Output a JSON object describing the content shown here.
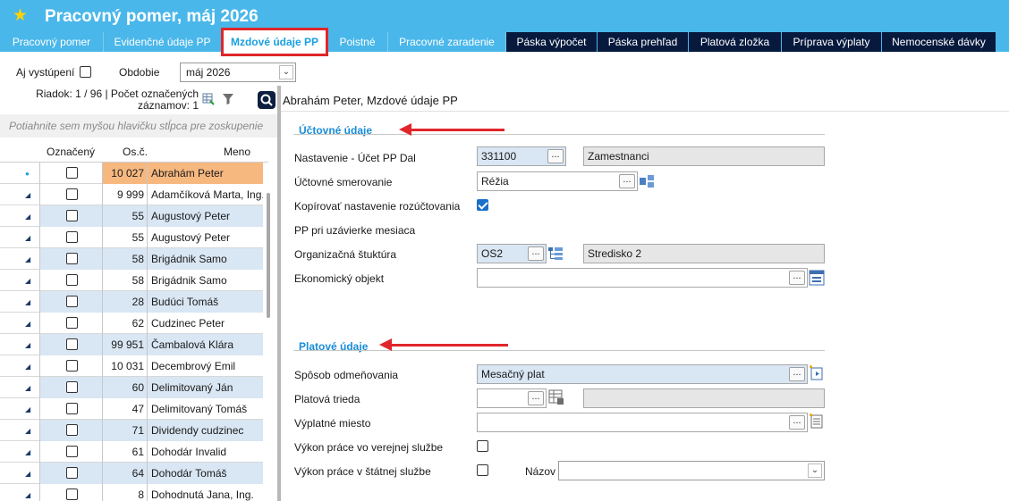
{
  "header": {
    "title": "Pracovný pomer, máj 2026",
    "tabs": [
      {
        "label": "Pracovný pomer"
      },
      {
        "label": "Evidenčné údaje PP"
      },
      {
        "label": "Mzdové údaje PP"
      },
      {
        "label": "Poistné"
      },
      {
        "label": "Pracovné zaradenie"
      },
      {
        "label": "Páska výpočet"
      },
      {
        "label": "Páska prehľad"
      },
      {
        "label": "Platová zložka"
      },
      {
        "label": "Príprava výplaty"
      },
      {
        "label": "Nemocenské dávky"
      }
    ]
  },
  "filter": {
    "aj_vystupeni_label": "Aj vystúpení",
    "obdobie_label": "Obdobie",
    "obdobie_value": "máj 2026"
  },
  "left": {
    "info_line1": "Riadok: 1 / 96 | Počet označených",
    "info_line2": "záznamov: 1",
    "group_hint": "Potiahnite sem myšou hlavičku stĺpca pre zoskupenie",
    "columns": {
      "oznaceny": "Označený",
      "osc": "Os.č.",
      "meno": "Meno"
    },
    "rows": [
      {
        "osc": "10 027",
        "meno": "Abrahám Peter"
      },
      {
        "osc": "9 999",
        "meno": "Adamčíková Marta, Ing."
      },
      {
        "osc": "55",
        "meno": "Augustový Peter"
      },
      {
        "osc": "55",
        "meno": "Augustový Peter"
      },
      {
        "osc": "58",
        "meno": "Brigádnik Samo"
      },
      {
        "osc": "58",
        "meno": "Brigádnik Samo"
      },
      {
        "osc": "28",
        "meno": "Budúci Tomáš"
      },
      {
        "osc": "62",
        "meno": "Cudzinec Peter"
      },
      {
        "osc": "99 951",
        "meno": "Čambalová Klára"
      },
      {
        "osc": "10 031",
        "meno": "Decembrový Emil"
      },
      {
        "osc": "60",
        "meno": "Delimitovaný Ján"
      },
      {
        "osc": "47",
        "meno": "Delimitovaný Tomáš"
      },
      {
        "osc": "71",
        "meno": "Dividendy cudzinec"
      },
      {
        "osc": "61",
        "meno": "Dohodár Invalid"
      },
      {
        "osc": "64",
        "meno": "Dohodár Tomáš"
      },
      {
        "osc": "8",
        "meno": "Dohodnutá Jana, Ing."
      }
    ]
  },
  "right": {
    "title": "Abrahám Peter, Mzdové údaje PP",
    "section1": "Účtovné údaje",
    "section2": "Platové údaje",
    "fields": {
      "nastavenie_label": "Nastavenie - Účet PP Dal",
      "nastavenie_value": "331100",
      "nastavenie_desc": "Zamestnanci",
      "smerovanie_label": "Účtovné smerovanie",
      "smerovanie_value": "Réžia",
      "kopirovat_label": "Kopírovať nastavenie rozúčtovania",
      "pp_uzavierke_label": "PP pri uzávierke mesiaca",
      "org_label": "Organizačná štuktúra",
      "org_value": "OS2",
      "org_desc": "Stredisko 2",
      "eko_label": "Ekonomický objekt",
      "sposob_label": "Spôsob odmeňovania",
      "sposob_value": "Mesačný plat",
      "trieda_label": "Platová trieda",
      "miesto_label": "Výplatné miesto",
      "verejnej_label": "Výkon práce vo verejnej službe",
      "statnej_label": "Výkon práce v štátnej službe",
      "nazov_label": "Názov"
    }
  }
}
